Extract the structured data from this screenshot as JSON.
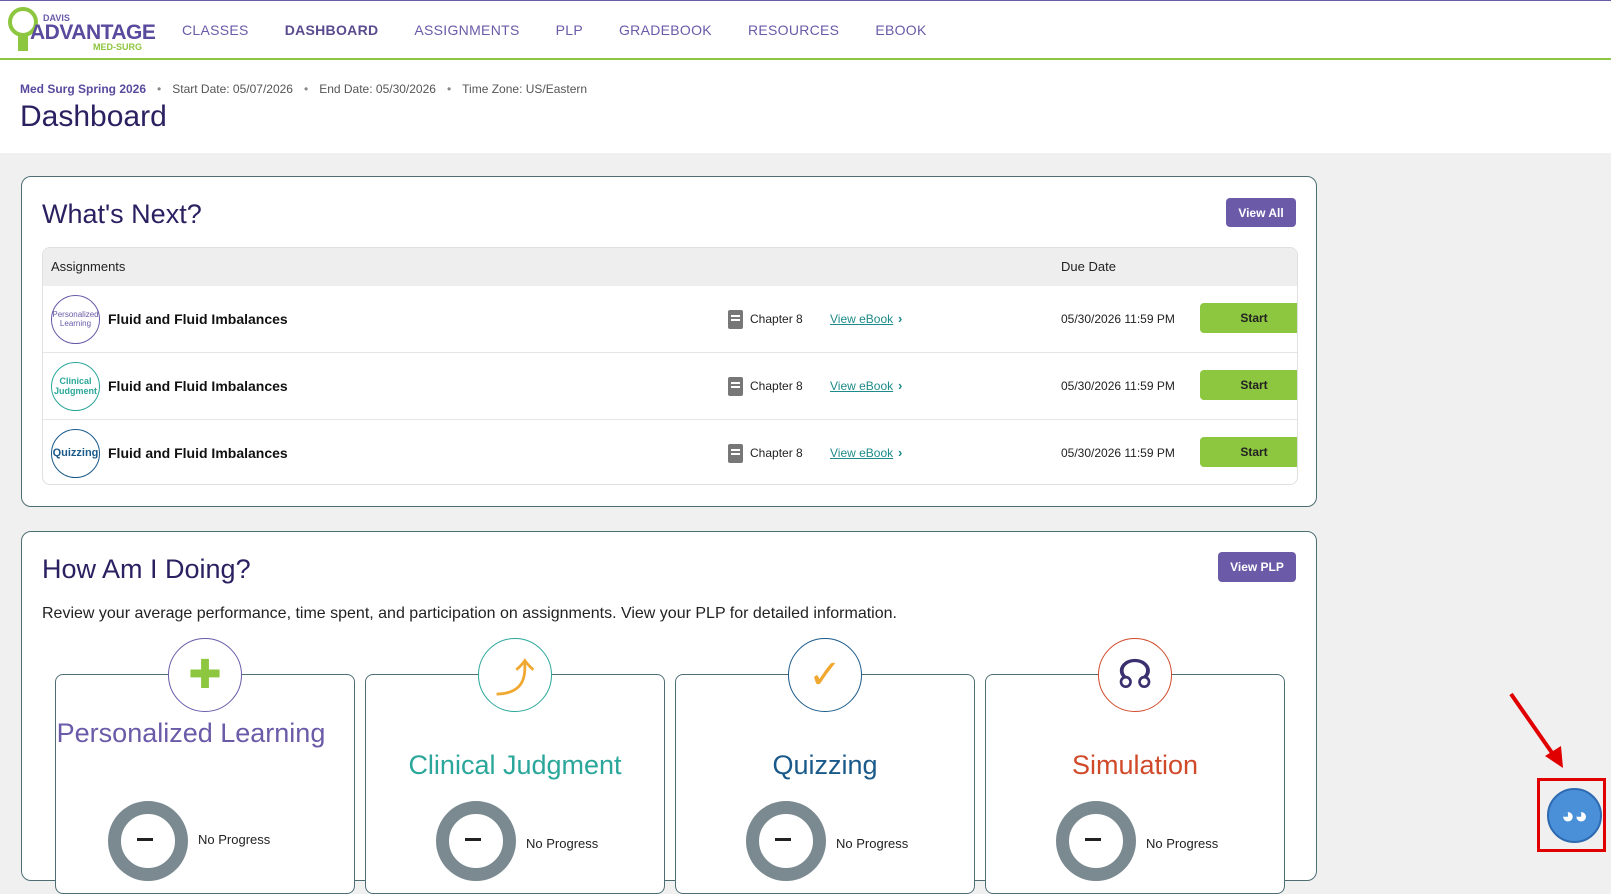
{
  "nav": {
    "logo": {
      "davis": "DAVIS",
      "advantage": "ADVANTAGE",
      "sub": "MED-SURG"
    },
    "links": [
      "CLASSES",
      "DASHBOARD",
      "ASSIGNMENTS",
      "PLP",
      "GRADEBOOK",
      "RESOURCES",
      "EBOOK"
    ],
    "active": "DASHBOARD"
  },
  "header": {
    "course": "Med Surg Spring 2026",
    "start_date": "Start Date: 05/07/2026",
    "end_date": "End Date: 05/30/2026",
    "time_zone": "Time Zone: US/Eastern",
    "title": "Dashboard"
  },
  "whats_next": {
    "title": "What's Next?",
    "view_all_label": "View All",
    "columns": {
      "assignments": "Assignments",
      "due_date": "Due Date"
    },
    "rows": [
      {
        "badge": "Personalized Learning",
        "title": "Fluid and Fluid Imbalances",
        "chapter": "Chapter 8",
        "ebook": "View eBook",
        "due": "05/30/2026  11:59 PM",
        "action": "Start"
      },
      {
        "badge": "Clinical Judgment",
        "title": "Fluid and Fluid Imbalances",
        "chapter": "Chapter 8",
        "ebook": "View eBook",
        "due": "05/30/2026  11:59 PM",
        "action": "Start"
      },
      {
        "badge": "Quizzing",
        "title": "Fluid and Fluid Imbalances",
        "chapter": "Chapter 8",
        "ebook": "View eBook",
        "due": "05/30/2026  11:59 PM",
        "action": "Start"
      }
    ]
  },
  "how_am_i_doing": {
    "title": "How Am I Doing?",
    "view_plp_label": "View PLP",
    "description": "Review your average performance, time spent, and participation on assignments. View your PLP for detailed information.",
    "tiles": [
      {
        "name": "Personalized Learning",
        "status": "No Progress",
        "color": "#6a5aa8",
        "icon": "puzzle-icon"
      },
      {
        "name": "Clinical Judgment",
        "status": "No Progress",
        "color": "#2aa79a",
        "icon": "arrows-icon"
      },
      {
        "name": "Quizzing",
        "status": "No Progress",
        "color": "#1a5a8a",
        "icon": "checkmark-icon"
      },
      {
        "name": "Simulation",
        "status": "No Progress",
        "color": "#d04a2a",
        "icon": "stethoscope-icon"
      }
    ]
  },
  "colors": {
    "brand_purple": "#6a5aa8",
    "brand_green": "#8dc63f",
    "title_navy": "#2b2060",
    "link_teal": "#1e8a8a"
  }
}
